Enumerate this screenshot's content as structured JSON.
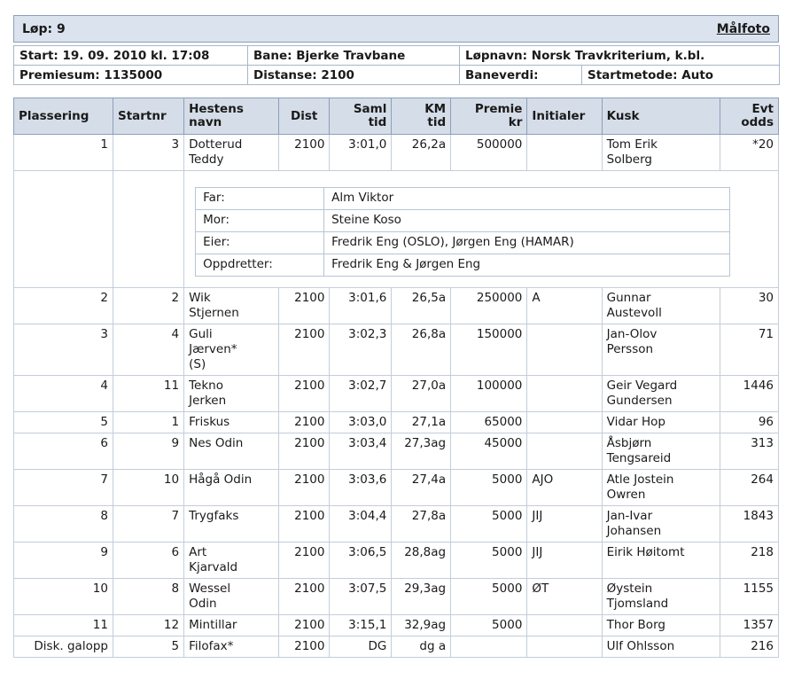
{
  "header": {
    "lop": "Løp: 9",
    "malfoto": "Målfoto"
  },
  "info": {
    "start": "Start: 19. 09. 2010 kl. 17:08",
    "bane": "Bane: Bjerke Travbane",
    "lopnavn": "Løpnavn: Norsk Travkriterium, k.bl.",
    "premiesum": "Premiesum: 1135000",
    "distanse": "Distanse: 2100",
    "baneverdi": "Baneverdi:",
    "startmetode": "Startmetode: Auto"
  },
  "columns": {
    "plassering": "Plassering",
    "startnr": "Startnr",
    "hestens_1": "Hestens",
    "hestens_2": "navn",
    "dist": "Dist",
    "saml_1": "Saml",
    "saml_2": "tid",
    "km_1": "KM",
    "km_2": "tid",
    "premie_1": "Premie",
    "premie_2": "kr",
    "initialer": "Initialer",
    "kusk": "Kusk",
    "odds_1": "Evt",
    "odds_2": "odds"
  },
  "rows": [
    {
      "plass": "1",
      "startnr": "3",
      "navn1": "Dotterud",
      "navn2": "Teddy",
      "navn3": "",
      "dist": "2100",
      "saml": "3:01,0",
      "km": "26,2a",
      "premie": "500000",
      "init": "",
      "kusk1": "Tom Erik",
      "kusk2": "Solberg",
      "odds": "*20"
    },
    {
      "plass": "2",
      "startnr": "2",
      "navn1": "Wik",
      "navn2": "Stjernen",
      "navn3": "",
      "dist": "2100",
      "saml": "3:01,6",
      "km": "26,5a",
      "premie": "250000",
      "init": "A",
      "kusk1": "Gunnar",
      "kusk2": "Austevoll",
      "odds": "30"
    },
    {
      "plass": "3",
      "startnr": "4",
      "navn1": "Guli",
      "navn2": "Jærven*",
      "navn3": "(S)",
      "dist": "2100",
      "saml": "3:02,3",
      "km": "26,8a",
      "premie": "150000",
      "init": "",
      "kusk1": "Jan-Olov",
      "kusk2": "Persson",
      "odds": "71"
    },
    {
      "plass": "4",
      "startnr": "11",
      "navn1": "Tekno",
      "navn2": "Jerken",
      "navn3": "",
      "dist": "2100",
      "saml": "3:02,7",
      "km": "27,0a",
      "premie": "100000",
      "init": "",
      "kusk1": "Geir Vegard",
      "kusk2": "Gundersen",
      "odds": "1446"
    },
    {
      "plass": "5",
      "startnr": "1",
      "navn1": "Friskus",
      "navn2": "",
      "navn3": "",
      "dist": "2100",
      "saml": "3:03,0",
      "km": "27,1a",
      "premie": "65000",
      "init": "",
      "kusk1": "Vidar Hop",
      "kusk2": "",
      "odds": "96"
    },
    {
      "plass": "6",
      "startnr": "9",
      "navn1": "Nes Odin",
      "navn2": "",
      "navn3": "",
      "dist": "2100",
      "saml": "3:03,4",
      "km": "27,3ag",
      "premie": "45000",
      "init": "",
      "kusk1": "Åsbjørn",
      "kusk2": "Tengsareid",
      "odds": "313"
    },
    {
      "plass": "7",
      "startnr": "10",
      "navn1": "Hågå Odin",
      "navn2": "",
      "navn3": "",
      "dist": "2100",
      "saml": "3:03,6",
      "km": "27,4a",
      "premie": "5000",
      "init": "AJO",
      "kusk1": "Atle Jostein",
      "kusk2": "Owren",
      "odds": "264"
    },
    {
      "plass": "8",
      "startnr": "7",
      "navn1": "Trygfaks",
      "navn2": "",
      "navn3": "",
      "dist": "2100",
      "saml": "3:04,4",
      "km": "27,8a",
      "premie": "5000",
      "init": "JIJ",
      "kusk1": "Jan-Ivar",
      "kusk2": "Johansen",
      "odds": "1843"
    },
    {
      "plass": "9",
      "startnr": "6",
      "navn1": "Art",
      "navn2": "Kjarvald",
      "navn3": "",
      "dist": "2100",
      "saml": "3:06,5",
      "km": "28,8ag",
      "premie": "5000",
      "init": "JIJ",
      "kusk1": "Eirik Høitomt",
      "kusk2": "",
      "odds": "218"
    },
    {
      "plass": "10",
      "startnr": "8",
      "navn1": "Wessel",
      "navn2": "Odin",
      "navn3": "",
      "dist": "2100",
      "saml": "3:07,5",
      "km": "29,3ag",
      "premie": "5000",
      "init": "ØT",
      "kusk1": "Øystein",
      "kusk2": "Tjomsland",
      "odds": "1155"
    },
    {
      "plass": "11",
      "startnr": "12",
      "navn1": "Mintillar",
      "navn2": "",
      "navn3": "",
      "dist": "2100",
      "saml": "3:15,1",
      "km": "32,9ag",
      "premie": "5000",
      "init": "",
      "kusk1": "Thor Borg",
      "kusk2": "",
      "odds": "1357"
    },
    {
      "plass": "Disk. galopp",
      "startnr": "5",
      "navn1": "Filofax*",
      "navn2": "",
      "navn3": "",
      "dist": "2100",
      "saml": "DG",
      "km": "dg a",
      "premie": "",
      "init": "",
      "kusk1": "Ulf Ohlsson",
      "kusk2": "",
      "odds": "216"
    }
  ],
  "details": {
    "far_label": "Far:",
    "far": "Alm Viktor",
    "mor_label": "Mor:",
    "mor": "Steine Koso",
    "eier_label": "Eier:",
    "eier": "Fredrik Eng (OSLO), Jørgen Eng (HAMAR)",
    "oppdretter_label": "Oppdretter:",
    "oppdretter": "Fredrik Eng & Jørgen Eng"
  }
}
